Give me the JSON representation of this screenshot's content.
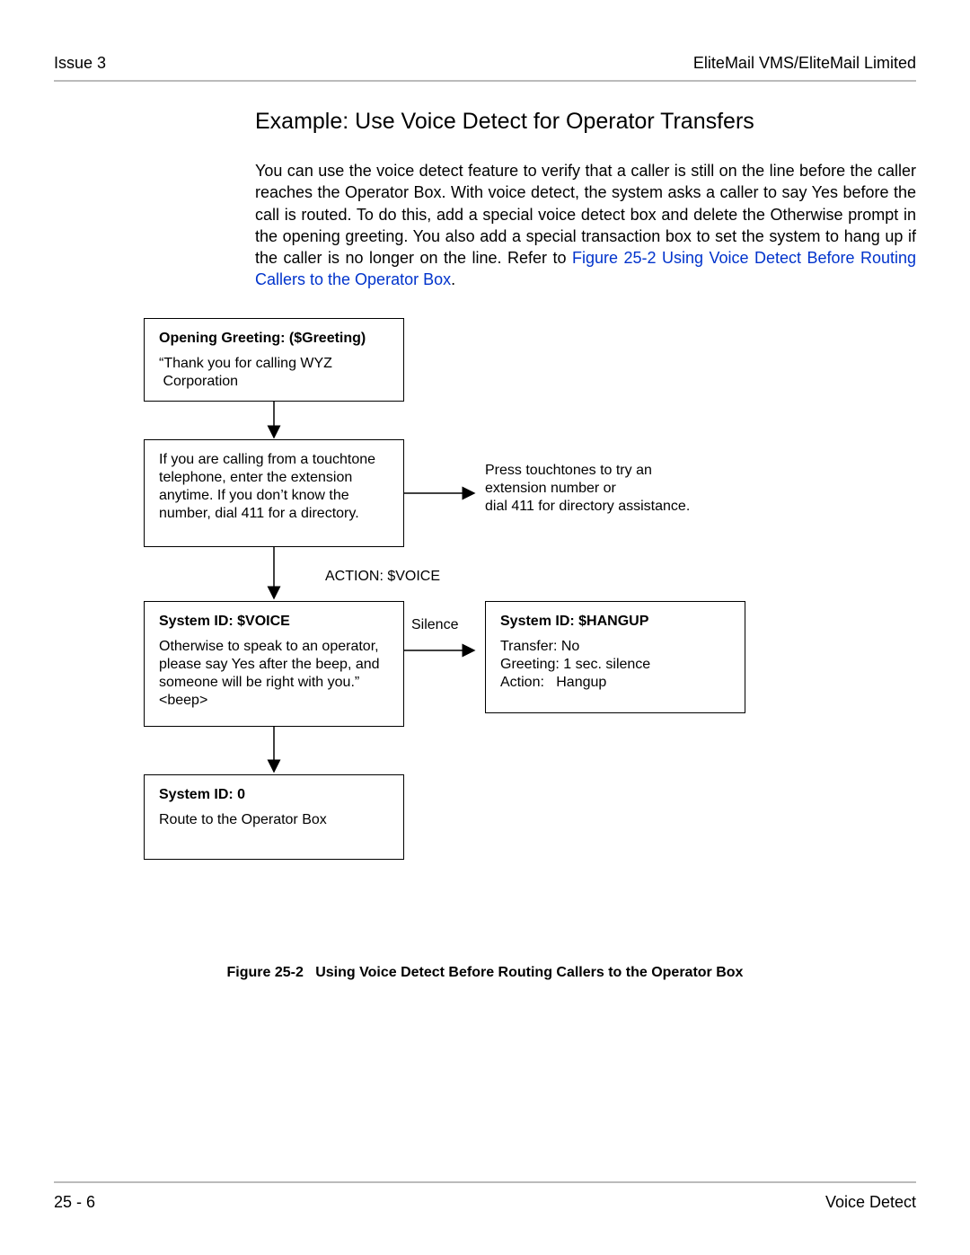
{
  "header": {
    "left": "Issue 3",
    "right": "EliteMail VMS/EliteMail Limited"
  },
  "title": "Example: Use Voice Detect for Operator Transfers",
  "body": {
    "p1a": "You can use the voice detect feature to verify that a caller is still on the line before the caller reaches the Operator Box. With voice detect, the system asks a caller to say Yes before the call is routed. To do this, add a special voice detect box and delete the Otherwise prompt in the opening greeting. You also add a special transaction box to set the system to hang up if the caller is no longer on the line. Refer to ",
    "p1link": "Figure 25-2 Using Voice Detect Before Routing Callers to the Operator Box",
    "p1b": "."
  },
  "diagram": {
    "box1": {
      "title": "Opening Greeting: ($Greeting)",
      "text": "“Thank you for calling WYZ\n Corporation"
    },
    "box2": {
      "text": "If you are calling from a touchtone telephone, enter the extension anytime.  If you don’t know the number, dial 411 for a directory."
    },
    "side1": "Press touchtones to try an extension number or\ndial 411 for directory assistance.",
    "actionLabel": "ACTION: $VOICE",
    "box3": {
      "title": "System ID: $VOICE",
      "text": "Otherwise to speak to an operator, please say Yes after the beep, and someone will be right with you.”\n<beep>"
    },
    "silenceLabel": "Silence",
    "box4": {
      "title": "System ID: $HANGUP",
      "l1": "Transfer: No",
      "l2": "Greeting: 1 sec. silence",
      "l3": "Action:   Hangup"
    },
    "box5": {
      "title": "System ID: 0",
      "text": "Route to the Operator Box"
    }
  },
  "figcaption": "Figure 25-2   Using Voice Detect Before Routing Callers to the Operator Box",
  "footer": {
    "left": "25 - 6",
    "right": "Voice Detect"
  }
}
